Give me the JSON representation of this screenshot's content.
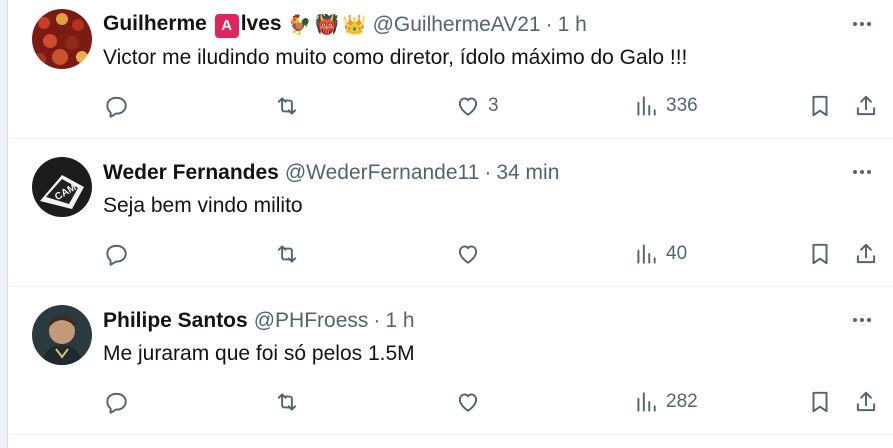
{
  "colors": {
    "text_primary": "#0f1419",
    "text_secondary": "#536471",
    "divider": "#eff3f4",
    "badge_red": "#e0245e"
  },
  "icons": {
    "reply": "reply-icon",
    "retweet": "retweet-icon",
    "like": "heart-icon",
    "views": "views-icon",
    "bookmark": "bookmark-icon",
    "share": "share-icon",
    "more": "more-icon"
  },
  "tweets": [
    {
      "name_pre": "Guilherme ",
      "name_badge": "A",
      "name_post": "lves",
      "name_emojis": [
        "🐓",
        "👹",
        "👑"
      ],
      "handle": "@GuilhermeAV21",
      "separator": "·",
      "time": "1 h",
      "text": "Victor me iludindo muito como diretor, ídolo máximo do Galo !!!",
      "likes": "3",
      "views": "336"
    },
    {
      "name": "Weder Fernandes",
      "handle": "@WederFernande11",
      "separator": "·",
      "time": "34 min",
      "text": "Seja bem vindo milito",
      "likes": "",
      "views": "40"
    },
    {
      "name": "Philipe Santos",
      "handle": "@PHFroess",
      "separator": "·",
      "time": "1 h",
      "text": "Me juraram que foi só pelos 1.5M",
      "likes": "",
      "views": "282"
    }
  ]
}
